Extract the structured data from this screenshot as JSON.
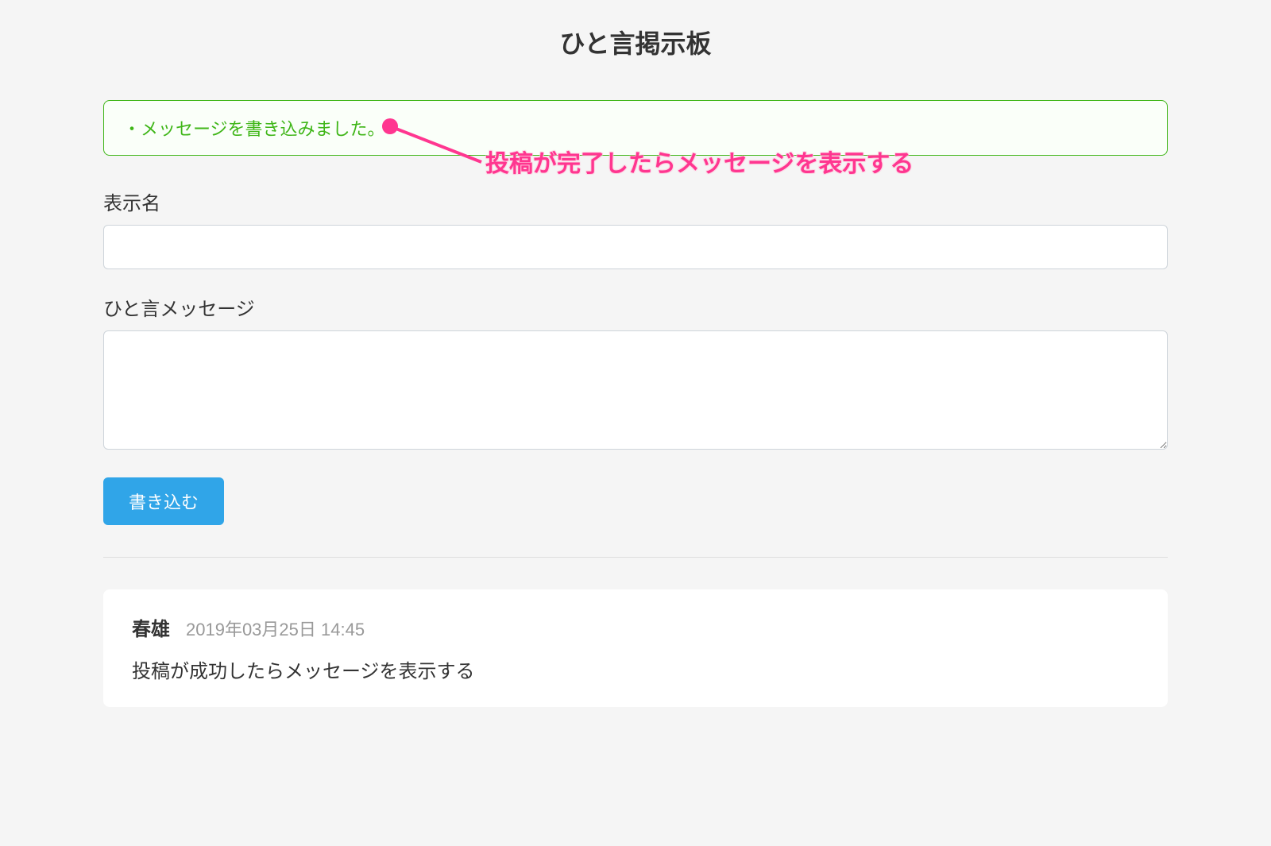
{
  "page": {
    "title": "ひと言掲示板"
  },
  "alert": {
    "message": "・メッセージを書き込みました。"
  },
  "annotation": {
    "text": "投稿が完了したらメッセージを表示する"
  },
  "form": {
    "display_name_label": "表示名",
    "display_name_value": "",
    "message_label": "ひと言メッセージ",
    "message_value": "",
    "submit_label": "書き込む"
  },
  "posts": [
    {
      "author": "春雄",
      "timestamp": "2019年03月25日 14:45",
      "body": "投稿が成功したらメッセージを表示する"
    }
  ]
}
